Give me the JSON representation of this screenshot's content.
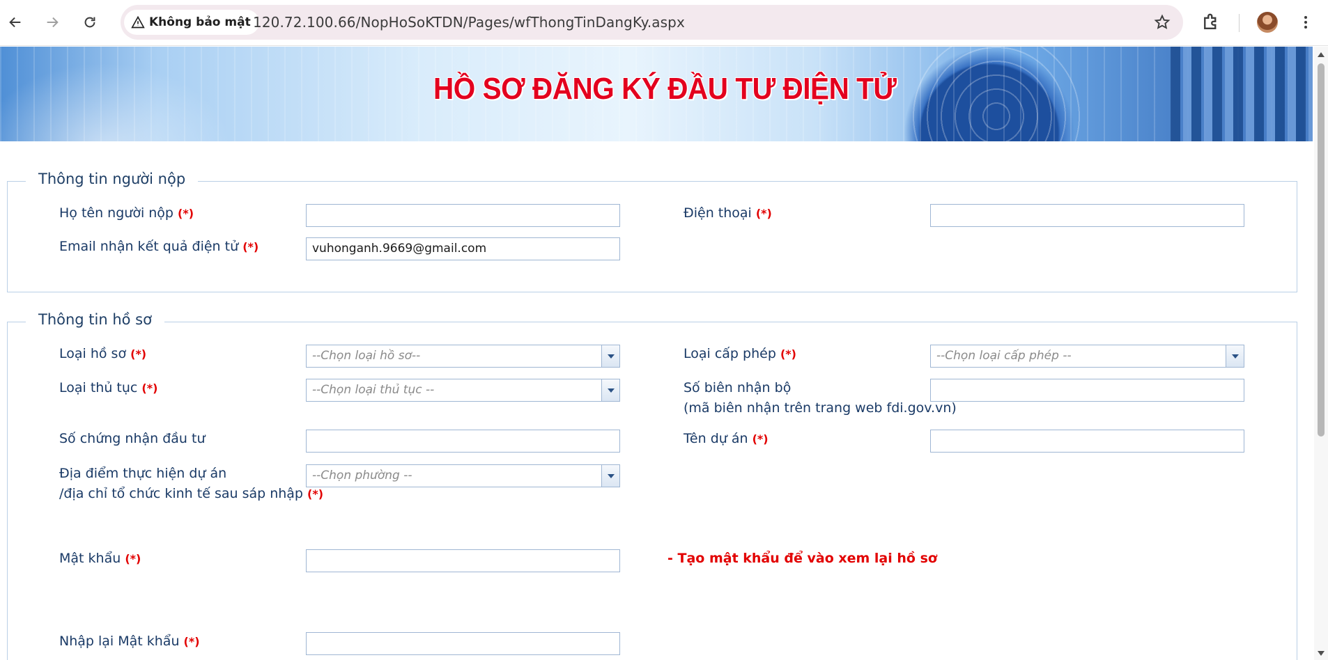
{
  "browser": {
    "security_label": "Không bảo mật",
    "url": "120.72.100.66/NopHoSoKTDN/Pages/wfThongTinDangKy.aspx"
  },
  "banner": {
    "title": "HỒ SƠ ĐĂNG KÝ ĐẦU TƯ ĐIỆN TỬ"
  },
  "required_mark": "(*)",
  "submitter": {
    "legend": "Thông tin người nộp",
    "name_label": "Họ tên người nộp",
    "name_value": "",
    "phone_label": "Điện thoại",
    "phone_value": "",
    "email_label": "Email nhận kết quả điện tử",
    "email_value": "vuhonganh.9669@gmail.com"
  },
  "dossier": {
    "legend": "Thông tin hồ sơ",
    "type_label": "Loại hồ sơ",
    "type_placeholder": "--Chọn loại hồ sơ--",
    "license_label": "Loại cấp phép",
    "license_placeholder": "--Chọn loại cấp phép --",
    "procedure_label": "Loại thủ tục",
    "procedure_placeholder": "--Chọn loại thủ tục --",
    "receipt_label": "Số biên nhận bộ",
    "receipt_sub": "(mã biên nhận trên trang web fdi.gov.vn)",
    "receipt_value": "",
    "cert_label": "Số chứng nhận đầu tư",
    "cert_value": "",
    "project_label": "Tên dự án",
    "project_value": "",
    "location_label_1": "Địa điểm thực hiện dự án",
    "location_label_2": "/địa chỉ tổ chức kinh tế sau sáp nhập",
    "location_placeholder": "--Chọn phường --",
    "password_label": "Mật khẩu",
    "password_value": "",
    "password_note": "- Tạo mật khẩu để vào xem lại hồ sơ",
    "confirm_label": "Nhập lại Mật khẩu",
    "confirm_value": ""
  },
  "colors": {
    "label": "#1a3a66",
    "required": "#e20000",
    "border": "#9fb6d3"
  }
}
